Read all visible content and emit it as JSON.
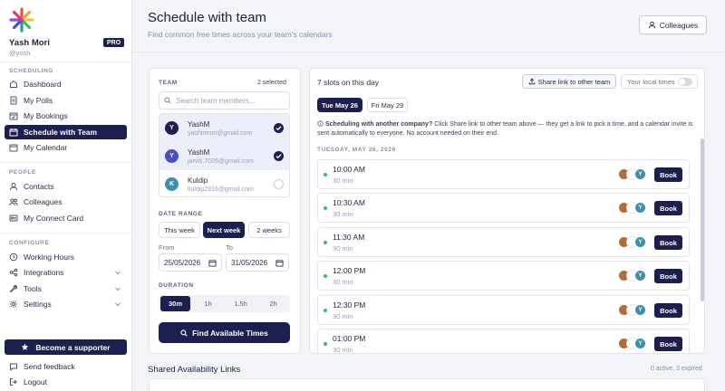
{
  "user": {
    "name": "Yash Mori",
    "handle": "@yosh",
    "badge": "PRO"
  },
  "sidebar": {
    "sections": [
      {
        "label": "SCHEDULING"
      },
      {
        "label": "PEOPLE"
      },
      {
        "label": "CONFIGURE"
      }
    ],
    "items": [
      {
        "label": "Dashboard",
        "icon": "home-icon"
      },
      {
        "label": "My Polls",
        "icon": "document-icon"
      },
      {
        "label": "My Bookings",
        "icon": "calendar-check-icon"
      },
      {
        "label": "Schedule with Team",
        "icon": "team-calendar-icon",
        "active": true
      },
      {
        "label": "My Calendar",
        "icon": "calendar-icon"
      },
      {
        "label": "Contacts",
        "icon": "user-icon"
      },
      {
        "label": "Colleagues",
        "icon": "users-icon"
      },
      {
        "label": "My Connect Card",
        "icon": "card-icon"
      },
      {
        "label": "Working Hours",
        "icon": "clock-icon"
      },
      {
        "label": "Integrations",
        "icon": "share-icon"
      },
      {
        "label": "Tools",
        "icon": "wrench-icon"
      },
      {
        "label": "Settings",
        "icon": "gear-icon"
      }
    ],
    "supporter_label": "Become a supporter",
    "feedback_label": "Send feedback",
    "logout_label": "Logout"
  },
  "header": {
    "title": "Schedule with team",
    "subtitle": "Find common free times across your team's calendars",
    "colleagues_button": "Colleagues"
  },
  "team": {
    "label": "TEAM",
    "selected_text": "2 selected",
    "search_placeholder": "Search team members...",
    "members": [
      {
        "initial": "Y",
        "name": "YashM",
        "email": "yashnmori@gmail.com",
        "selected": true,
        "color": "#1c1f4f"
      },
      {
        "initial": "Y",
        "name": "YashM",
        "email": "jarvis.7026@gmail.com",
        "selected": true,
        "color": "#4a4fc9"
      },
      {
        "initial": "K",
        "name": "Kuldip",
        "email": "kuldip2916@gmail.com",
        "selected": false,
        "color": "#3d8fb0"
      }
    ]
  },
  "date_range": {
    "label": "DATE RANGE",
    "options": [
      "This week",
      "Next week",
      "2 weeks"
    ],
    "selected": "Next week",
    "from_label": "From",
    "to_label": "To",
    "from_value": "25/05/2026",
    "to_value": "31/05/2026"
  },
  "duration": {
    "label": "DURATION",
    "options": [
      "30m",
      "1h",
      "1.5h",
      "2h"
    ],
    "selected": "30m"
  },
  "find_button": "Find Available Times",
  "results": {
    "slots_count": "7 slots on this day",
    "share_button": "Share link to other team",
    "local_times_label": "Your local times",
    "day_tabs": [
      "Tue May 26",
      "Fri May 29"
    ],
    "info_bold": "Scheduling with another company?",
    "info_text": "Click Share link to other team above — they get a link to pick a time, and a calendar invite is sent automatically to everyone. No account needed on their end.",
    "day_header": "TUESDAY, MAY 26, 2026",
    "book_label": "Book",
    "avatar_initial": "Y",
    "slots": [
      {
        "time": "10:00 AM",
        "duration": "30 min"
      },
      {
        "time": "10:30 AM",
        "duration": "30 min"
      },
      {
        "time": "11:30 AM",
        "duration": "30 min"
      },
      {
        "time": "12:00 PM",
        "duration": "30 min"
      },
      {
        "time": "12:30 PM",
        "duration": "30 min"
      },
      {
        "time": "01:00 PM",
        "duration": "30 min"
      }
    ]
  },
  "shared_links": {
    "title": "Shared Availability Links",
    "status": "0 active, 3 expired"
  }
}
